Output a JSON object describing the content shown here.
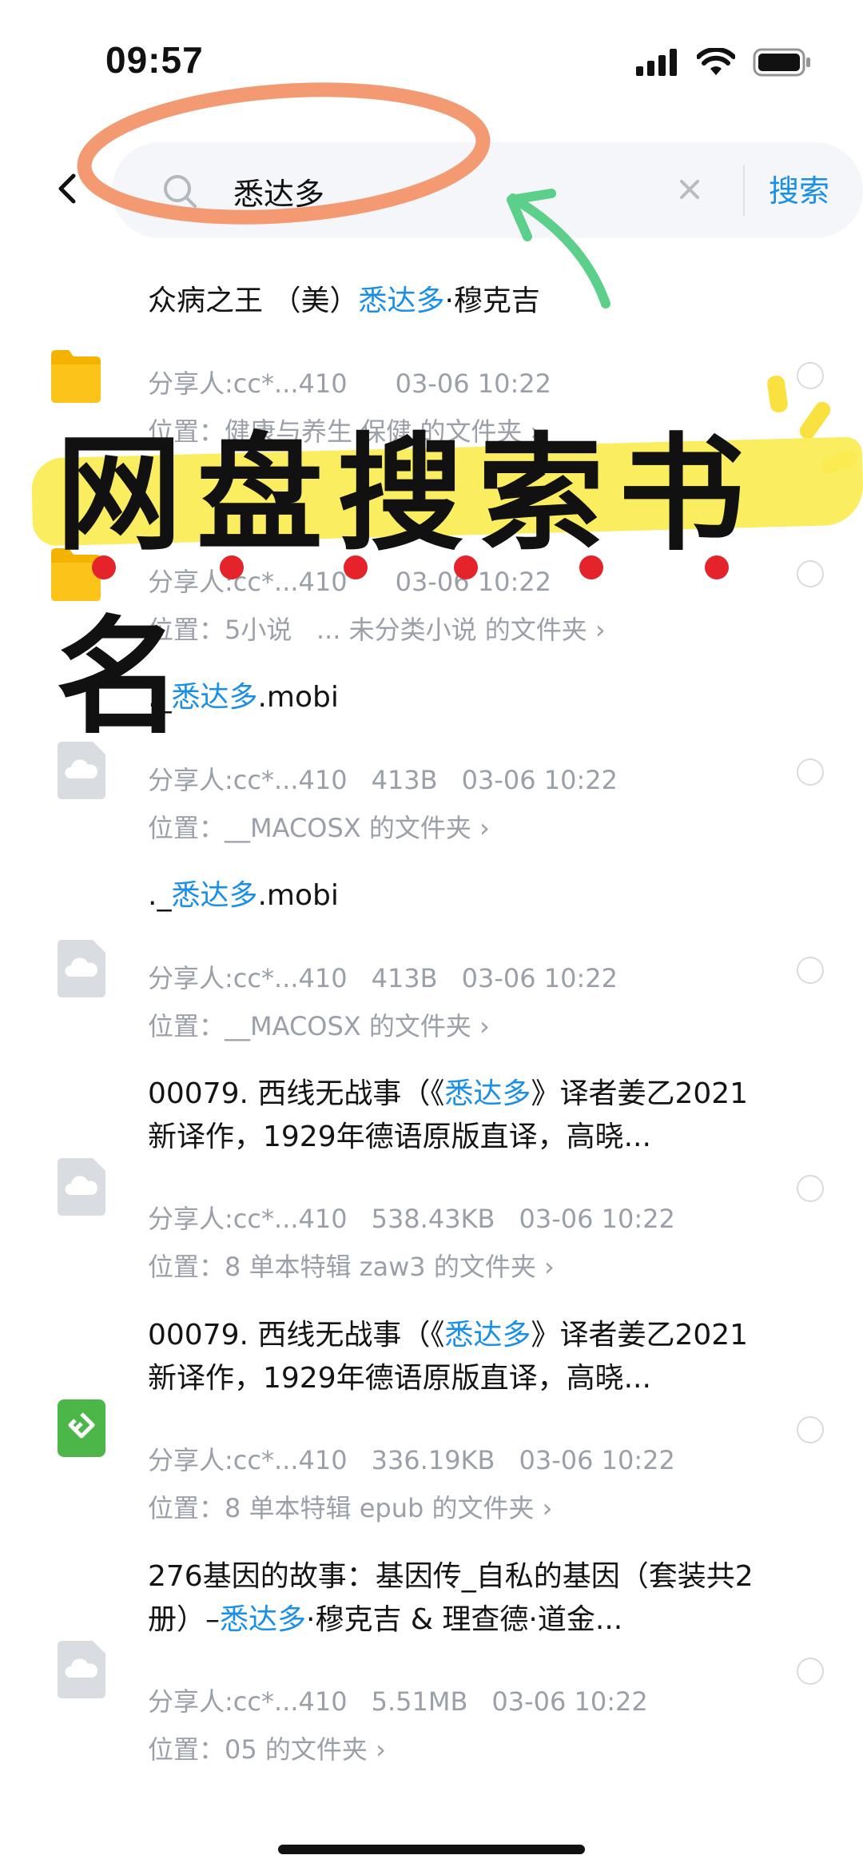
{
  "status": {
    "time": "09:57"
  },
  "search": {
    "query": "悉达多",
    "button": "搜索"
  },
  "highlight_color": "#1a8fe8",
  "items": [
    {
      "icon": "folder-icon",
      "title_before": "众病之王 （美）",
      "title_hl": "悉达多",
      "title_after": "·穆克吉",
      "sharer": "分享人:cc*...410",
      "size": "",
      "date": "03-06 10:22",
      "location": "位置：健康与养生 保健 的文件夹 ›"
    },
    {
      "icon": "folder-icon",
      "title_before": "",
      "title_hl": "",
      "title_after": "",
      "sharer": "分享人:cc*...410",
      "size": "",
      "date": "03-06 10:22",
      "location": "位置：5小说   ... 未分类小说 的文件夹 ›"
    },
    {
      "icon": "cloud-file-icon",
      "title_before": "._",
      "title_hl": "悉达多",
      "title_after": ".mobi",
      "sharer": "分享人:cc*...410",
      "size": "413B",
      "date": "03-06 10:22",
      "location": "位置：__MACOSX 的文件夹 ›"
    },
    {
      "icon": "cloud-file-icon",
      "title_before": "._",
      "title_hl": "悉达多",
      "title_after": ".mobi",
      "sharer": "分享人:cc*...410",
      "size": "413B",
      "date": "03-06 10:22",
      "location": "位置：__MACOSX 的文件夹 ›"
    },
    {
      "icon": "cloud-file-icon",
      "title_before": "00079. 西线无战事（《",
      "title_hl": "悉达多",
      "title_after": "》译者姜乙2021新译作，1929年德语原版直译，高晓...",
      "sharer": "分享人:cc*...410",
      "size": "538.43KB",
      "date": "03-06 10:22",
      "location": "位置：8 单本特辑 zaw3 的文件夹 ›"
    },
    {
      "icon": "epub-icon",
      "title_before": "00079. 西线无战事（《",
      "title_hl": "悉达多",
      "title_after": "》译者姜乙2021新译作，1929年德语原版直译，高晓...",
      "sharer": "分享人:cc*...410",
      "size": "336.19KB",
      "date": "03-06 10:22",
      "location": "位置：8 单本特辑 epub 的文件夹 ›"
    },
    {
      "icon": "cloud-file-icon",
      "title_before": "276基因的故事：基因传_自私的基因（套装共2册）–",
      "title_hl": "悉达多",
      "title_after": "·穆克吉 & 理查德·道金...",
      "sharer": "分享人:cc*...410",
      "size": "5.51MB",
      "date": "03-06 10:22",
      "location": "位置：05 的文件夹 ›"
    }
  ],
  "overlay": {
    "caption": "网盘搜索书名"
  }
}
